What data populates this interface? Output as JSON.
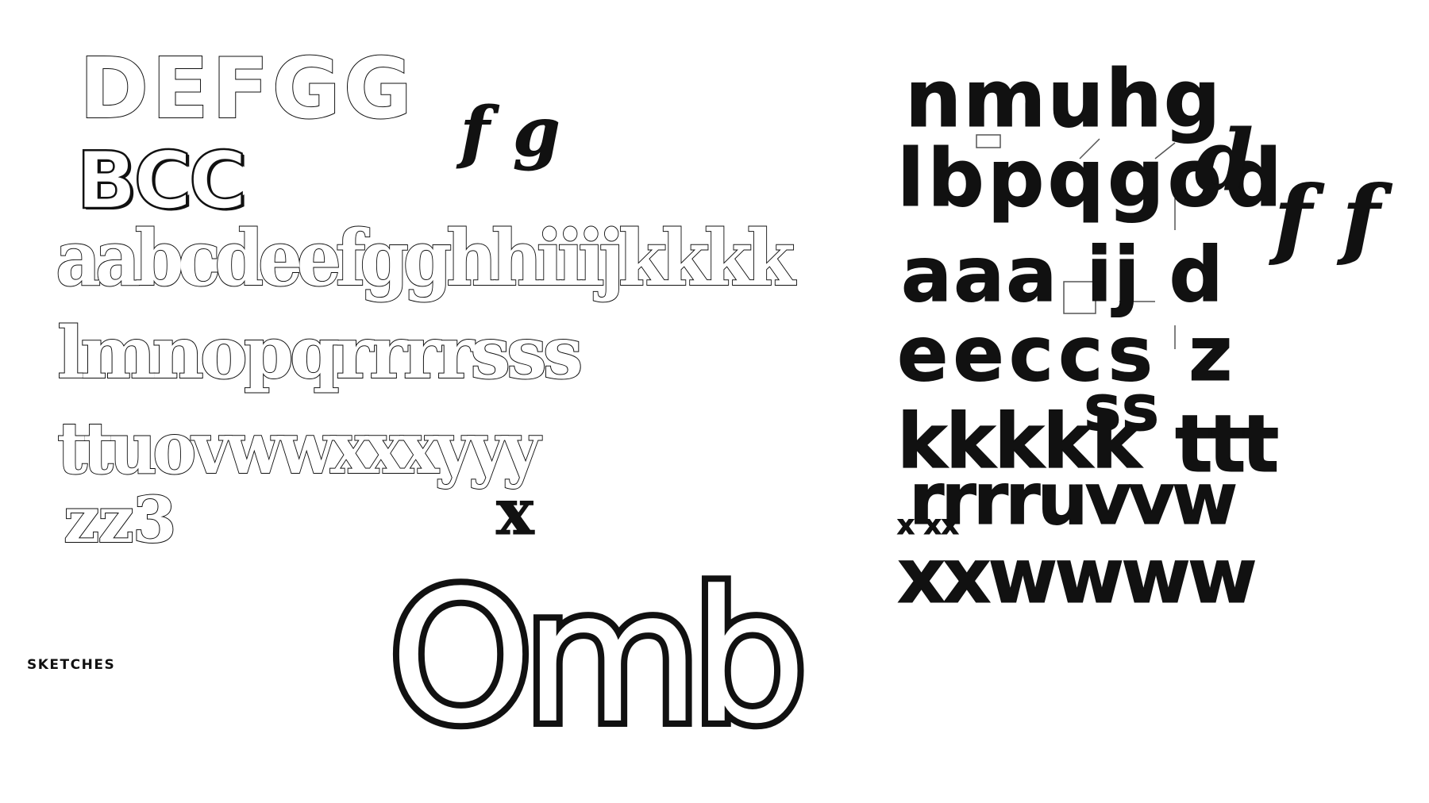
{
  "left_sheet": {
    "caps_row_1": "DEFGG",
    "caps_row_2": "BCC",
    "alt_f_g": "f g",
    "lowercase_row_1": "aabcdeefgghhiiijkkkk",
    "lowercase_row_2": "lmnopqrrrrsss",
    "lowercase_row_3": "ttuovwwxxxyyy",
    "lowercase_row_3_extra": "x",
    "lowercase_row_4": "zz3",
    "specimen_word": "Omb"
  },
  "right_sheet": {
    "row_1": "nmuhg",
    "row_2": "lbpqgod",
    "row_3": "aaa ij d",
    "row_4": "eeccs z",
    "row_4_extra": "ss",
    "row_5": "kkkkk",
    "row_5_extra": "ttt",
    "row_6": "rrrruvvw",
    "row_7": "x xx",
    "row_8": "xxwwww",
    "side_d": "d",
    "side_f": "f f"
  },
  "caption": "SKETCHES",
  "colors": {
    "ink": "#111111",
    "paper": "#ffffff"
  }
}
